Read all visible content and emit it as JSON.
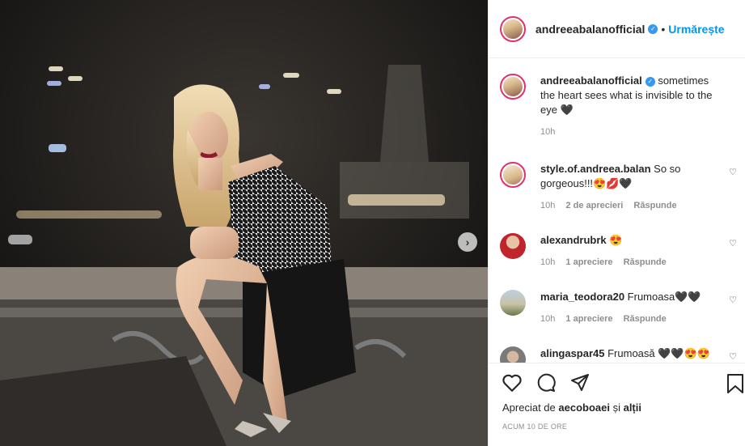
{
  "header": {
    "username": "andreeabalanofficial",
    "follow_label": "Urmărește",
    "separator": "•"
  },
  "caption": {
    "username": "andreeabalanofficial",
    "text": " sometimes the heart sees what is invisible to the eye 🖤",
    "time": "10h"
  },
  "comments": [
    {
      "username": "style.of.andreea.balan",
      "text": " So so gorgeous!!!😍💋🖤",
      "time": "10h",
      "likes": "2 de aprecieri",
      "reply": "Răspunde"
    },
    {
      "username": "alexandrubrk",
      "text": " 😍",
      "time": "10h",
      "likes": "1 apreciere",
      "reply": "Răspunde"
    },
    {
      "username": "maria_teodora20",
      "text": " Frumoasa🖤🖤",
      "time": "10h",
      "likes": "1 apreciere",
      "reply": "Răspunde"
    },
    {
      "username": "alingaspar45",
      "text": " Frumoasă 🖤🖤😍😍",
      "time": "",
      "likes": "",
      "reply": ""
    }
  ],
  "likes_line": {
    "prefix": "Apreciat de ",
    "user": "aecoboaei",
    "middle": " și ",
    "others": "alții"
  },
  "posted_ago": "ACUM 10 DE ORE",
  "icons": {
    "like": "heart-icon",
    "comment": "comment-icon",
    "share": "share-icon",
    "save": "bookmark-icon",
    "next": "chevron-right-icon"
  },
  "colors": {
    "link_blue": "#0095f6",
    "verified_blue": "#3897f0",
    "muted": "#8e8e8e"
  }
}
